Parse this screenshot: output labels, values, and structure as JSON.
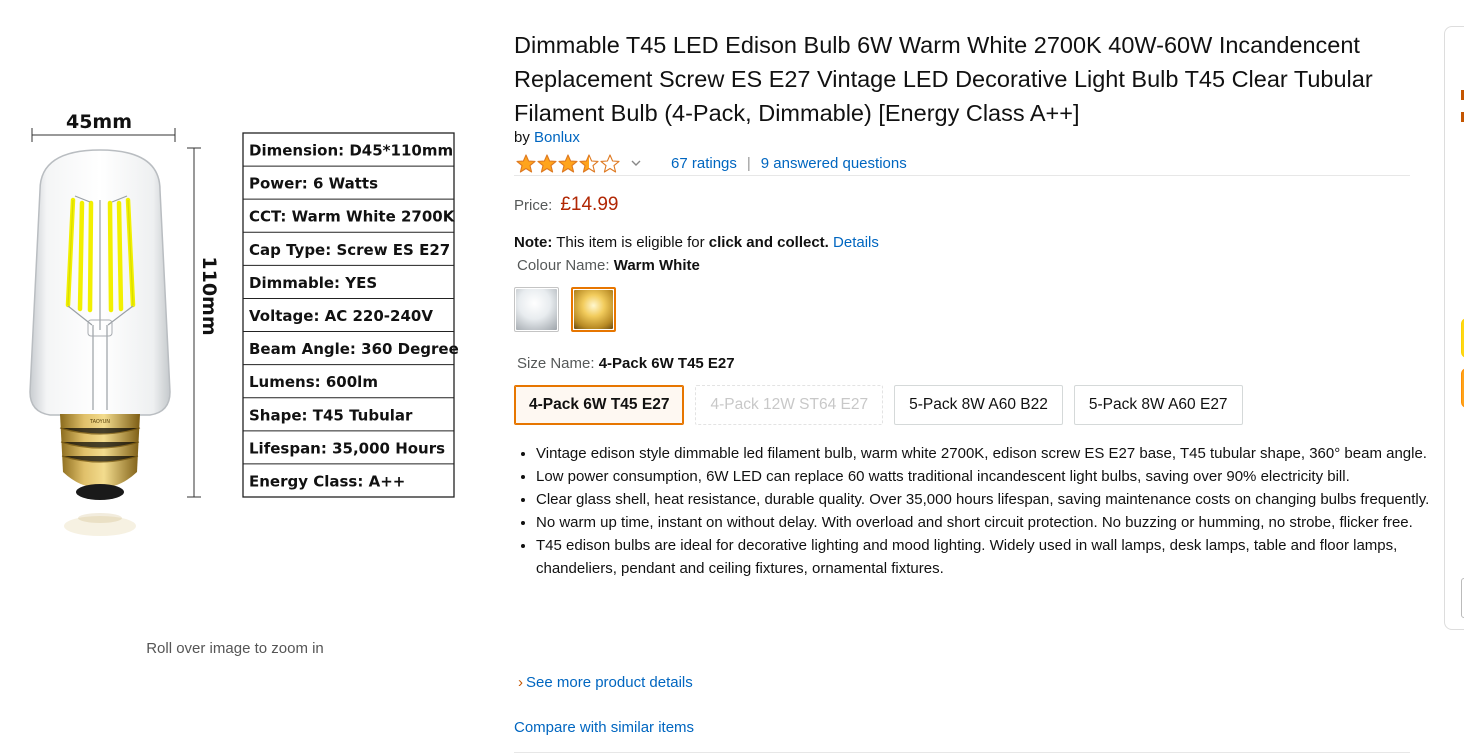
{
  "image": {
    "dim_width": "45mm",
    "dim_height": "110mm",
    "brand_mark": "TAOYUN",
    "specs": [
      "Dimension:  D45*110mm",
      "Power: 6 Watts",
      "CCT:  Warm White 2700K",
      "Cap Type: Screw ES E27",
      "Dimmable: YES",
      "Voltage: AC 220-240V",
      "Beam Angle: 360 Degree",
      "Lumens: 600lm",
      "Shape:  T45 Tubular",
      "Lifespan: 35,000 Hours",
      "Energy Class: A++"
    ],
    "zoom_hint": "Roll over image to zoom in"
  },
  "product": {
    "title": "Dimmable T45 LED Edison Bulb 6W Warm White 2700K 40W-60W Incandencent Replacement Screw ES E27 Vintage LED Decorative Light Bulb T45 Clear Tubular Filament Bulb (4-Pack, Dimmable) [Energy Class A++]",
    "by_label": "by",
    "brand": "Bonlux",
    "rating_stars": 3.5,
    "ratings_count": "67 ratings",
    "separator": "|",
    "answered": "9 answered questions",
    "price_label": "Price:",
    "price": "£14.99",
    "note_label": "Note:",
    "note_text": " This item is eligible for ",
    "note_bold": "click and collect.",
    "note_link": "Details",
    "colour_label": "Colour Name:",
    "colour_value": "Warm White",
    "swatches": [
      {
        "name": "Cool White",
        "color": "#e8ecef",
        "selected": false
      },
      {
        "name": "Warm White",
        "color": "#d9a536",
        "selected": true
      }
    ],
    "size_label": "Size Name:",
    "size_value": "4-Pack 6W T45 E27",
    "sizes": [
      {
        "label": "4-Pack 6W T45 E27",
        "state": "selected"
      },
      {
        "label": "4-Pack 12W ST64 E27",
        "state": "unavailable"
      },
      {
        "label": "5-Pack 8W A60 B22",
        "state": "normal"
      },
      {
        "label": "5-Pack 8W A60 E27",
        "state": "normal"
      }
    ],
    "bullets": [
      "Vintage edison style dimmable led filament bulb, warm white 2700K, edison screw ES E27 base, T45 tubular shape, 360° beam angle.",
      "Low power consumption, 6W LED can replace 60 watts traditional incandescent light bulbs, saving over 90% electricity bill.",
      "Clear glass shell, heat resistance, durable quality. Over 35,000 hours lifespan, saving maintenance costs on changing bulbs frequently.",
      "No warm up time, instant on without delay. With overload and short circuit protection. No buzzing or humming, no strobe, flicker free.",
      "T45 edison bulbs are ideal for decorative lighting and mood lighting. Widely used in wall lamps, desk lamps, table and floor lamps, chandeliers, pendant and ceiling fixtures, ornamental fixtures."
    ],
    "see_more_arrow": "›",
    "see_more": "See more product details",
    "compare": "Compare with similar items"
  },
  "colors": {
    "link": "#0066c0",
    "price": "#B12704",
    "star": "#FFA41C",
    "selected_border": "#e77600"
  }
}
